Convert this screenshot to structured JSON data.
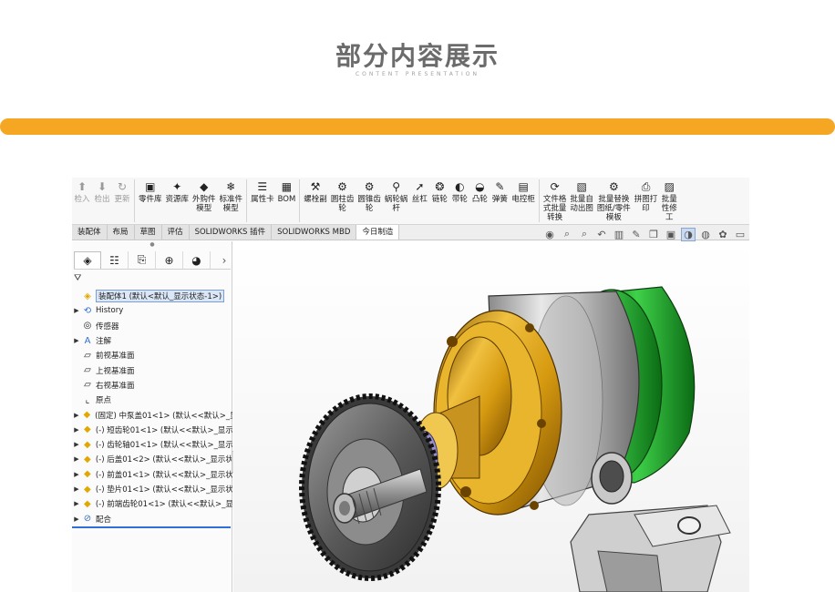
{
  "header": {
    "title": "部分内容展示",
    "subtitle": "CONTENT PRESENTATION"
  },
  "colors": {
    "accent_bar": "#f5a623",
    "tree_selection": "#dbe7f7"
  },
  "commands": [
    {
      "label": "检入",
      "icon": "pdm-checkin-icon",
      "glyph": "⬆",
      "dim": true
    },
    {
      "label": "检出",
      "icon": "pdm-checkout-icon",
      "glyph": "⬇",
      "dim": true
    },
    {
      "label": "更新",
      "icon": "update-icon",
      "glyph": "↻",
      "dim": true
    },
    {
      "label": "零件库",
      "icon": "part-library-icon",
      "glyph": "▣"
    },
    {
      "label": "资源库",
      "icon": "resource-library-icon",
      "glyph": "✦"
    },
    {
      "label": "外购件\n模型",
      "icon": "purchased-part-icon",
      "glyph": "◆"
    },
    {
      "label": "标准件\n模型",
      "icon": "standard-part-icon",
      "glyph": "❄"
    },
    {
      "label": "属性卡",
      "icon": "property-card-icon",
      "glyph": "☰"
    },
    {
      "label": "BOM",
      "icon": "bom-icon",
      "glyph": "▦"
    },
    {
      "label": "螺栓副",
      "icon": "bolt-pair-icon",
      "glyph": "⚒"
    },
    {
      "label": "圆柱齿\n轮",
      "icon": "spur-gear-icon",
      "glyph": "⚙"
    },
    {
      "label": "圆锥齿\n轮",
      "icon": "bevel-gear-icon",
      "glyph": "⚙"
    },
    {
      "label": "蜗轮蜗\n杆",
      "icon": "worm-gear-icon",
      "glyph": "⚲"
    },
    {
      "label": "丝杠",
      "icon": "lead-screw-icon",
      "glyph": "➚"
    },
    {
      "label": "链轮",
      "icon": "sprocket-icon",
      "glyph": "❂"
    },
    {
      "label": "带轮",
      "icon": "pulley-icon",
      "glyph": "◐"
    },
    {
      "label": "凸轮",
      "icon": "cam-icon",
      "glyph": "◒"
    },
    {
      "label": "弹簧",
      "icon": "spring-icon",
      "glyph": "✎"
    },
    {
      "label": "电控柜",
      "icon": "control-cabinet-icon",
      "glyph": "▤"
    },
    {
      "label": "文件格\n式批量\n转换",
      "icon": "batch-convert-icon",
      "glyph": "⟳"
    },
    {
      "label": "批量自\n动出图",
      "icon": "batch-drawing-icon",
      "glyph": "▧"
    },
    {
      "label": "批量替换\n图纸/零件\n模板",
      "icon": "batch-replace-icon",
      "glyph": "⚙"
    },
    {
      "label": "拼图打\n印",
      "icon": "print-icon",
      "glyph": "⎙"
    },
    {
      "label": "批量\n性修\n工",
      "icon": "batch-modify-icon",
      "glyph": "▨"
    }
  ],
  "tabs": [
    {
      "label": "装配体",
      "active": false
    },
    {
      "label": "布局",
      "active": false
    },
    {
      "label": "草图",
      "active": false
    },
    {
      "label": "评估",
      "active": false
    },
    {
      "label": "SOLIDWORKS 插件",
      "active": false
    },
    {
      "label": "SOLIDWORKS MBD",
      "active": false
    },
    {
      "label": "今日制造",
      "active": true
    }
  ],
  "view_tools": [
    {
      "icon": "view-orientation-icon",
      "glyph": "◉"
    },
    {
      "icon": "zoom-to-fit-icon",
      "glyph": "⌕"
    },
    {
      "icon": "zoom-area-icon",
      "glyph": "⌕"
    },
    {
      "icon": "previous-view-icon",
      "glyph": "↶"
    },
    {
      "icon": "section-view-icon",
      "glyph": "▥"
    },
    {
      "icon": "dynamic-annotation-icon",
      "glyph": "✎"
    },
    {
      "icon": "view-orientation-cube-icon",
      "glyph": "❒"
    },
    {
      "icon": "display-style-icon",
      "glyph": "▣"
    },
    {
      "icon": "hide-show-icon",
      "glyph": "◑"
    },
    {
      "icon": "edit-appearance-icon",
      "glyph": "◍"
    },
    {
      "icon": "scenes-icon",
      "glyph": "✿"
    },
    {
      "icon": "view-settings-icon",
      "glyph": "▭"
    }
  ],
  "feature_manager": {
    "tabs": [
      {
        "icon": "featuremanager-tree-icon",
        "glyph": "◈",
        "active": true
      },
      {
        "icon": "propertymanager-icon",
        "glyph": "☷"
      },
      {
        "icon": "configurationmanager-icon",
        "glyph": "⎘"
      },
      {
        "icon": "dimxpert-icon",
        "glyph": "⊕"
      },
      {
        "icon": "displaymanager-icon",
        "glyph": "◕"
      }
    ],
    "filter_icon": "filter-icon",
    "filter_glyph": "⛛",
    "tree": [
      {
        "text": "装配体1 (默认<默认_显示状态-1>)",
        "icon": "assembly-icon",
        "glyph": "◈",
        "expander": "",
        "root": true
      },
      {
        "text": "History",
        "icon": "history-icon",
        "glyph": "⟲",
        "expander": "▶"
      },
      {
        "text": "传感器",
        "icon": "sensor-icon",
        "glyph": "◎",
        "expander": ""
      },
      {
        "text": "注解",
        "icon": "annotation-icon",
        "glyph": "A",
        "expander": "▶"
      },
      {
        "text": "前视基准面",
        "icon": "plane-icon",
        "glyph": "▱",
        "expander": ""
      },
      {
        "text": "上视基准面",
        "icon": "plane-icon",
        "glyph": "▱",
        "expander": ""
      },
      {
        "text": "右视基准面",
        "icon": "plane-icon",
        "glyph": "▱",
        "expander": ""
      },
      {
        "text": "原点",
        "icon": "origin-icon",
        "glyph": "⌞",
        "expander": ""
      },
      {
        "text": "(固定) 中泵盖01<1> (默认<<默认>_显",
        "icon": "component-icon",
        "glyph": "◆",
        "expander": "▶"
      },
      {
        "text": "(-) 短齿轮01<1> (默认<<默认>_显示",
        "icon": "component-icon",
        "glyph": "◆",
        "expander": "▶"
      },
      {
        "text": "(-) 齿轮轴01<1> (默认<<默认>_显示",
        "icon": "component-icon",
        "glyph": "◆",
        "expander": "▶"
      },
      {
        "text": "(-) 后盖01<2> (默认<<默认>_显示状",
        "icon": "component-icon",
        "glyph": "◆",
        "expander": "▶"
      },
      {
        "text": "(-) 前盖01<1> (默认<<默认>_显示状",
        "icon": "component-icon",
        "glyph": "◆",
        "expander": "▶"
      },
      {
        "text": "(-) 垫片01<1> (默认<<默认>_显示状",
        "icon": "component-icon",
        "glyph": "◆",
        "expander": "▶"
      },
      {
        "text": "(-) 前端齿轮01<1> (默认<<默认>_显",
        "icon": "component-icon",
        "glyph": "◆",
        "expander": "▶"
      },
      {
        "text": "配合",
        "icon": "mates-icon",
        "glyph": "⊘",
        "expander": "▶"
      }
    ]
  }
}
